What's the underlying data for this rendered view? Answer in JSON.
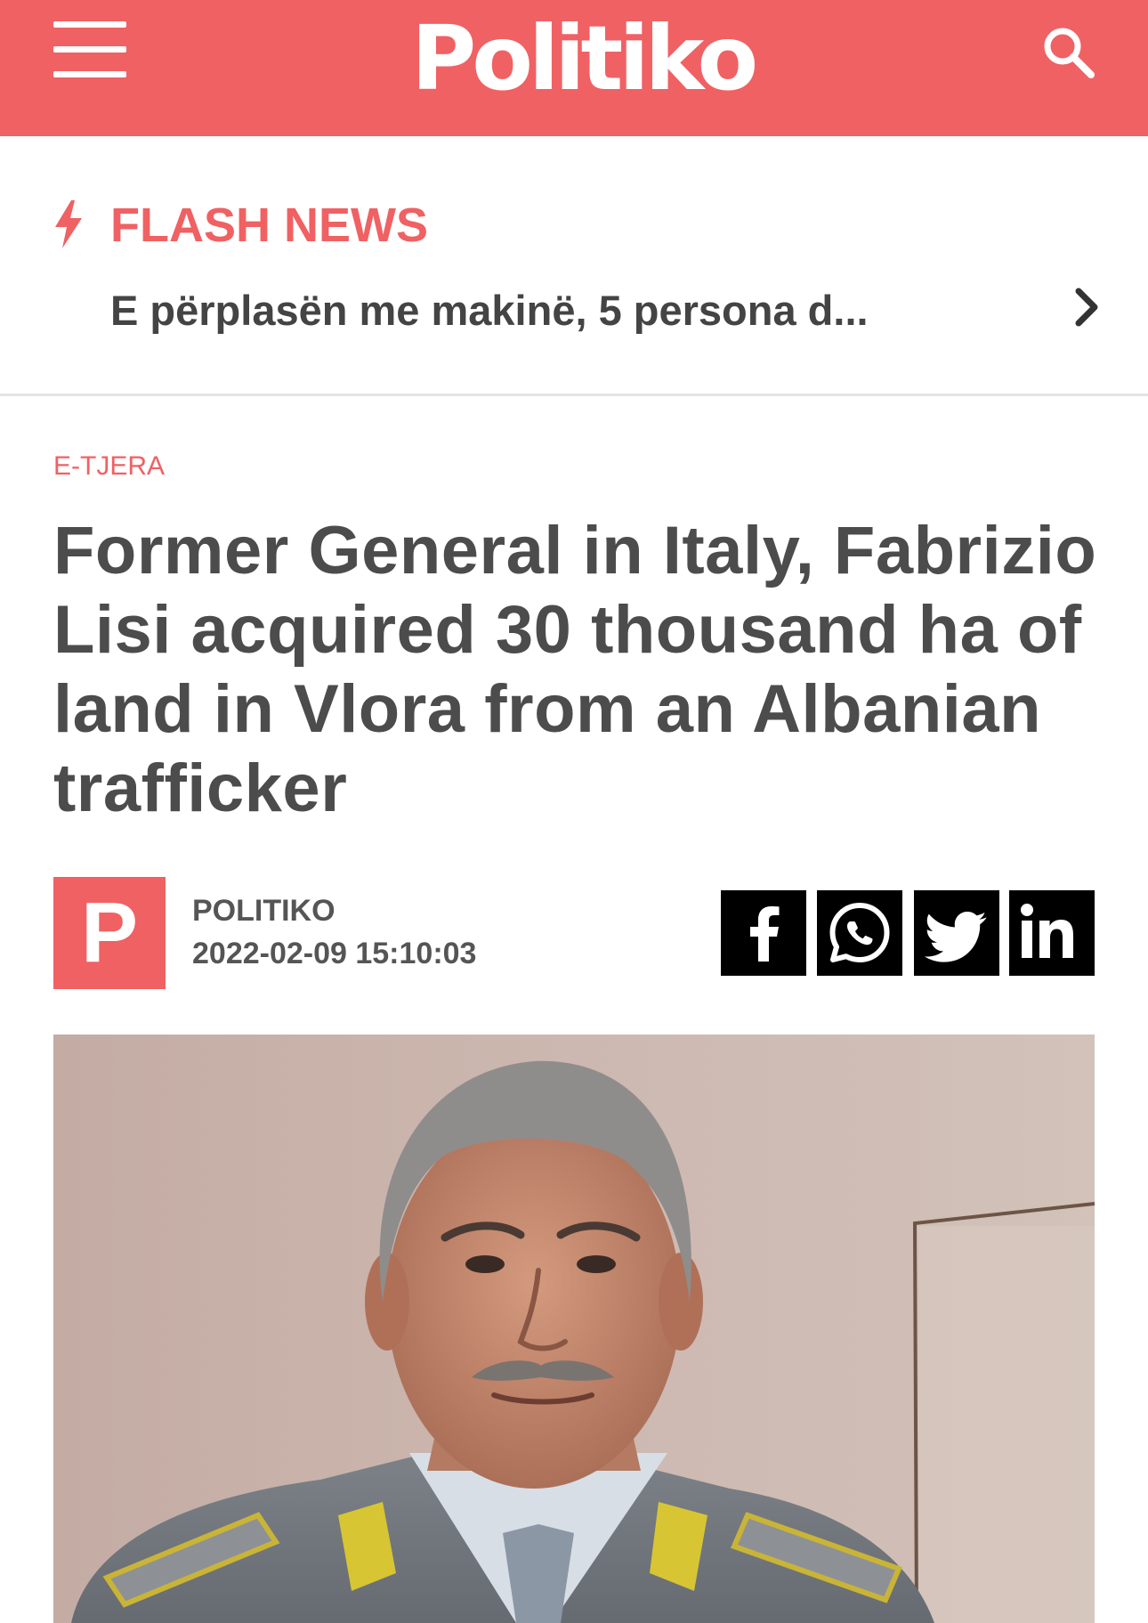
{
  "header": {
    "logo": "Politiko",
    "brand_color": "#f06163",
    "menu_icon": "hamburger-menu-icon",
    "search_icon": "search-icon"
  },
  "flash_news": {
    "title": "FLASH NEWS",
    "headline": "E përplasën me makinë, 5 persona d...",
    "bolt_icon": "lightning-bolt-icon",
    "next_icon": "chevron-right-icon"
  },
  "article": {
    "category": "E-TJERA",
    "headline": "Former General in Italy, Fabrizio Lisi acquired 30 thousand ha of land in Vlora from an Albanian trafficker",
    "author": {
      "avatar_letter": "P",
      "name": "POLITIKO",
      "date": "2022-02-09 15:10:03"
    },
    "share": [
      {
        "network": "facebook",
        "icon": "facebook-icon"
      },
      {
        "network": "whatsapp",
        "icon": "whatsapp-icon"
      },
      {
        "network": "twitter",
        "icon": "twitter-icon"
      },
      {
        "network": "linkedin",
        "icon": "linkedin-icon"
      }
    ],
    "image": {
      "subject": "portrait-photo"
    }
  }
}
